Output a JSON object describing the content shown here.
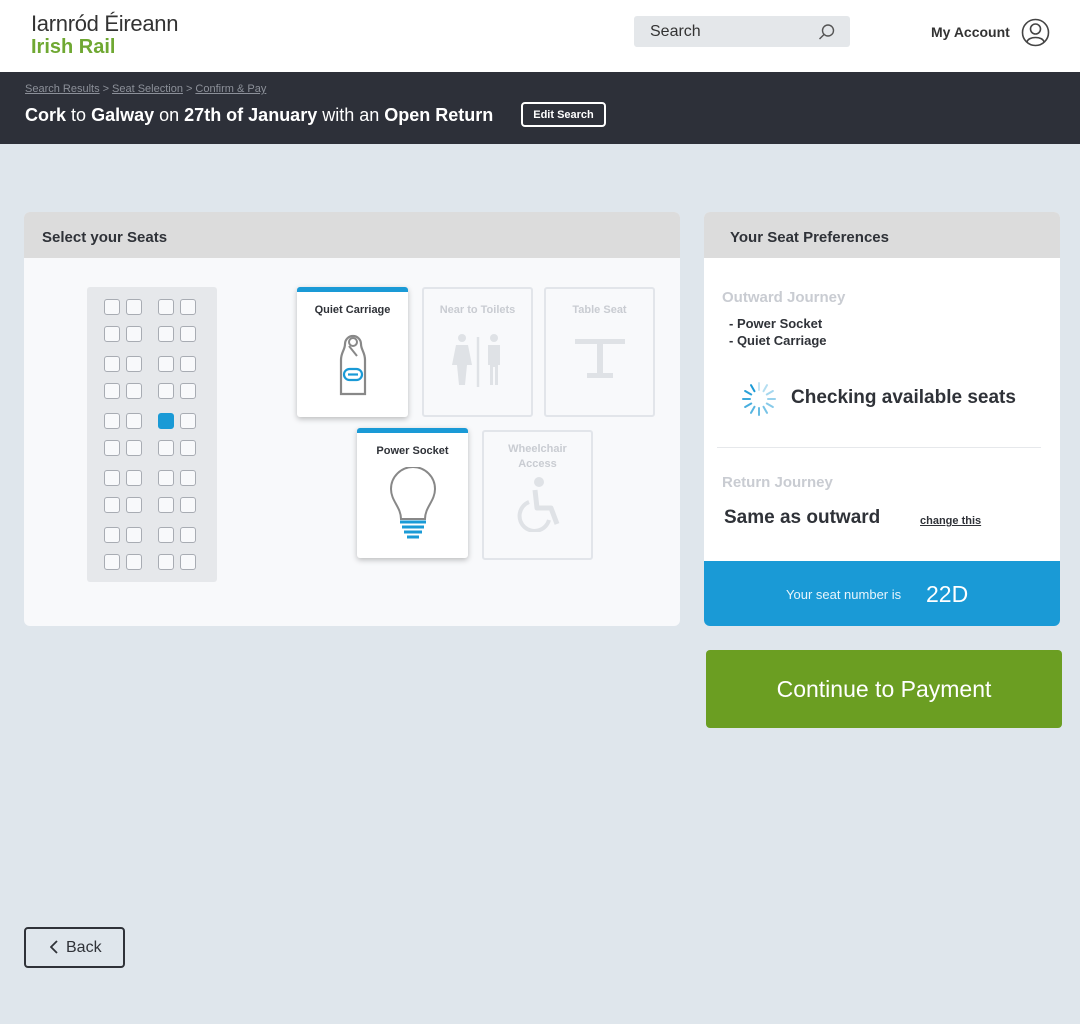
{
  "header": {
    "logo_line1": "Iarnród Éireann",
    "logo_line2": "Irish Rail",
    "search_placeholder": "Search",
    "account_label": "My Account"
  },
  "journey": {
    "breadcrumbs": [
      "Search Results",
      "Seat Selection",
      "Confirm & Pay"
    ],
    "breadcrumb_sep": ">",
    "from": "Cork",
    "to_word": "to",
    "to": "Galway",
    "on_word": "on",
    "date": "27th of January",
    "with_word": "with an",
    "ticket": "Open Return",
    "edit_label": "Edit Search"
  },
  "seats_panel": {
    "title": "Select your Seats",
    "preferences": [
      {
        "label": "Quiet Carriage",
        "icon": "door-hanger-icon",
        "active": true
      },
      {
        "label": "Near to Toilets",
        "icon": "toilets-icon",
        "active": false
      },
      {
        "label": "Table Seat",
        "icon": "table-icon",
        "active": false
      },
      {
        "label": "Power Socket",
        "icon": "lightbulb-icon",
        "active": true
      },
      {
        "label": "Wheelchair Access",
        "icon": "wheelchair-icon",
        "active": false
      }
    ],
    "seat_map": {
      "rows": 10,
      "seats_per_row": 4,
      "selected_row": 4,
      "selected_seat": 3
    }
  },
  "preferences_panel": {
    "title": "Your Seat Preferences",
    "outward_heading": "Outward Journey",
    "outward_items": [
      "- Power Socket",
      "- Quiet Carriage"
    ],
    "checking_text": "Checking available seats",
    "return_heading": "Return Journey",
    "return_value": "Same as outward",
    "change_label": "change this",
    "seat_number_label": "Your seat number is",
    "seat_number": "22D"
  },
  "actions": {
    "continue_label": "Continue to Payment",
    "back_label": "Back"
  },
  "colors": {
    "accent_blue": "#1a9ad6",
    "brand_green": "#6b9e22",
    "dark_bar": "#2d3039"
  }
}
